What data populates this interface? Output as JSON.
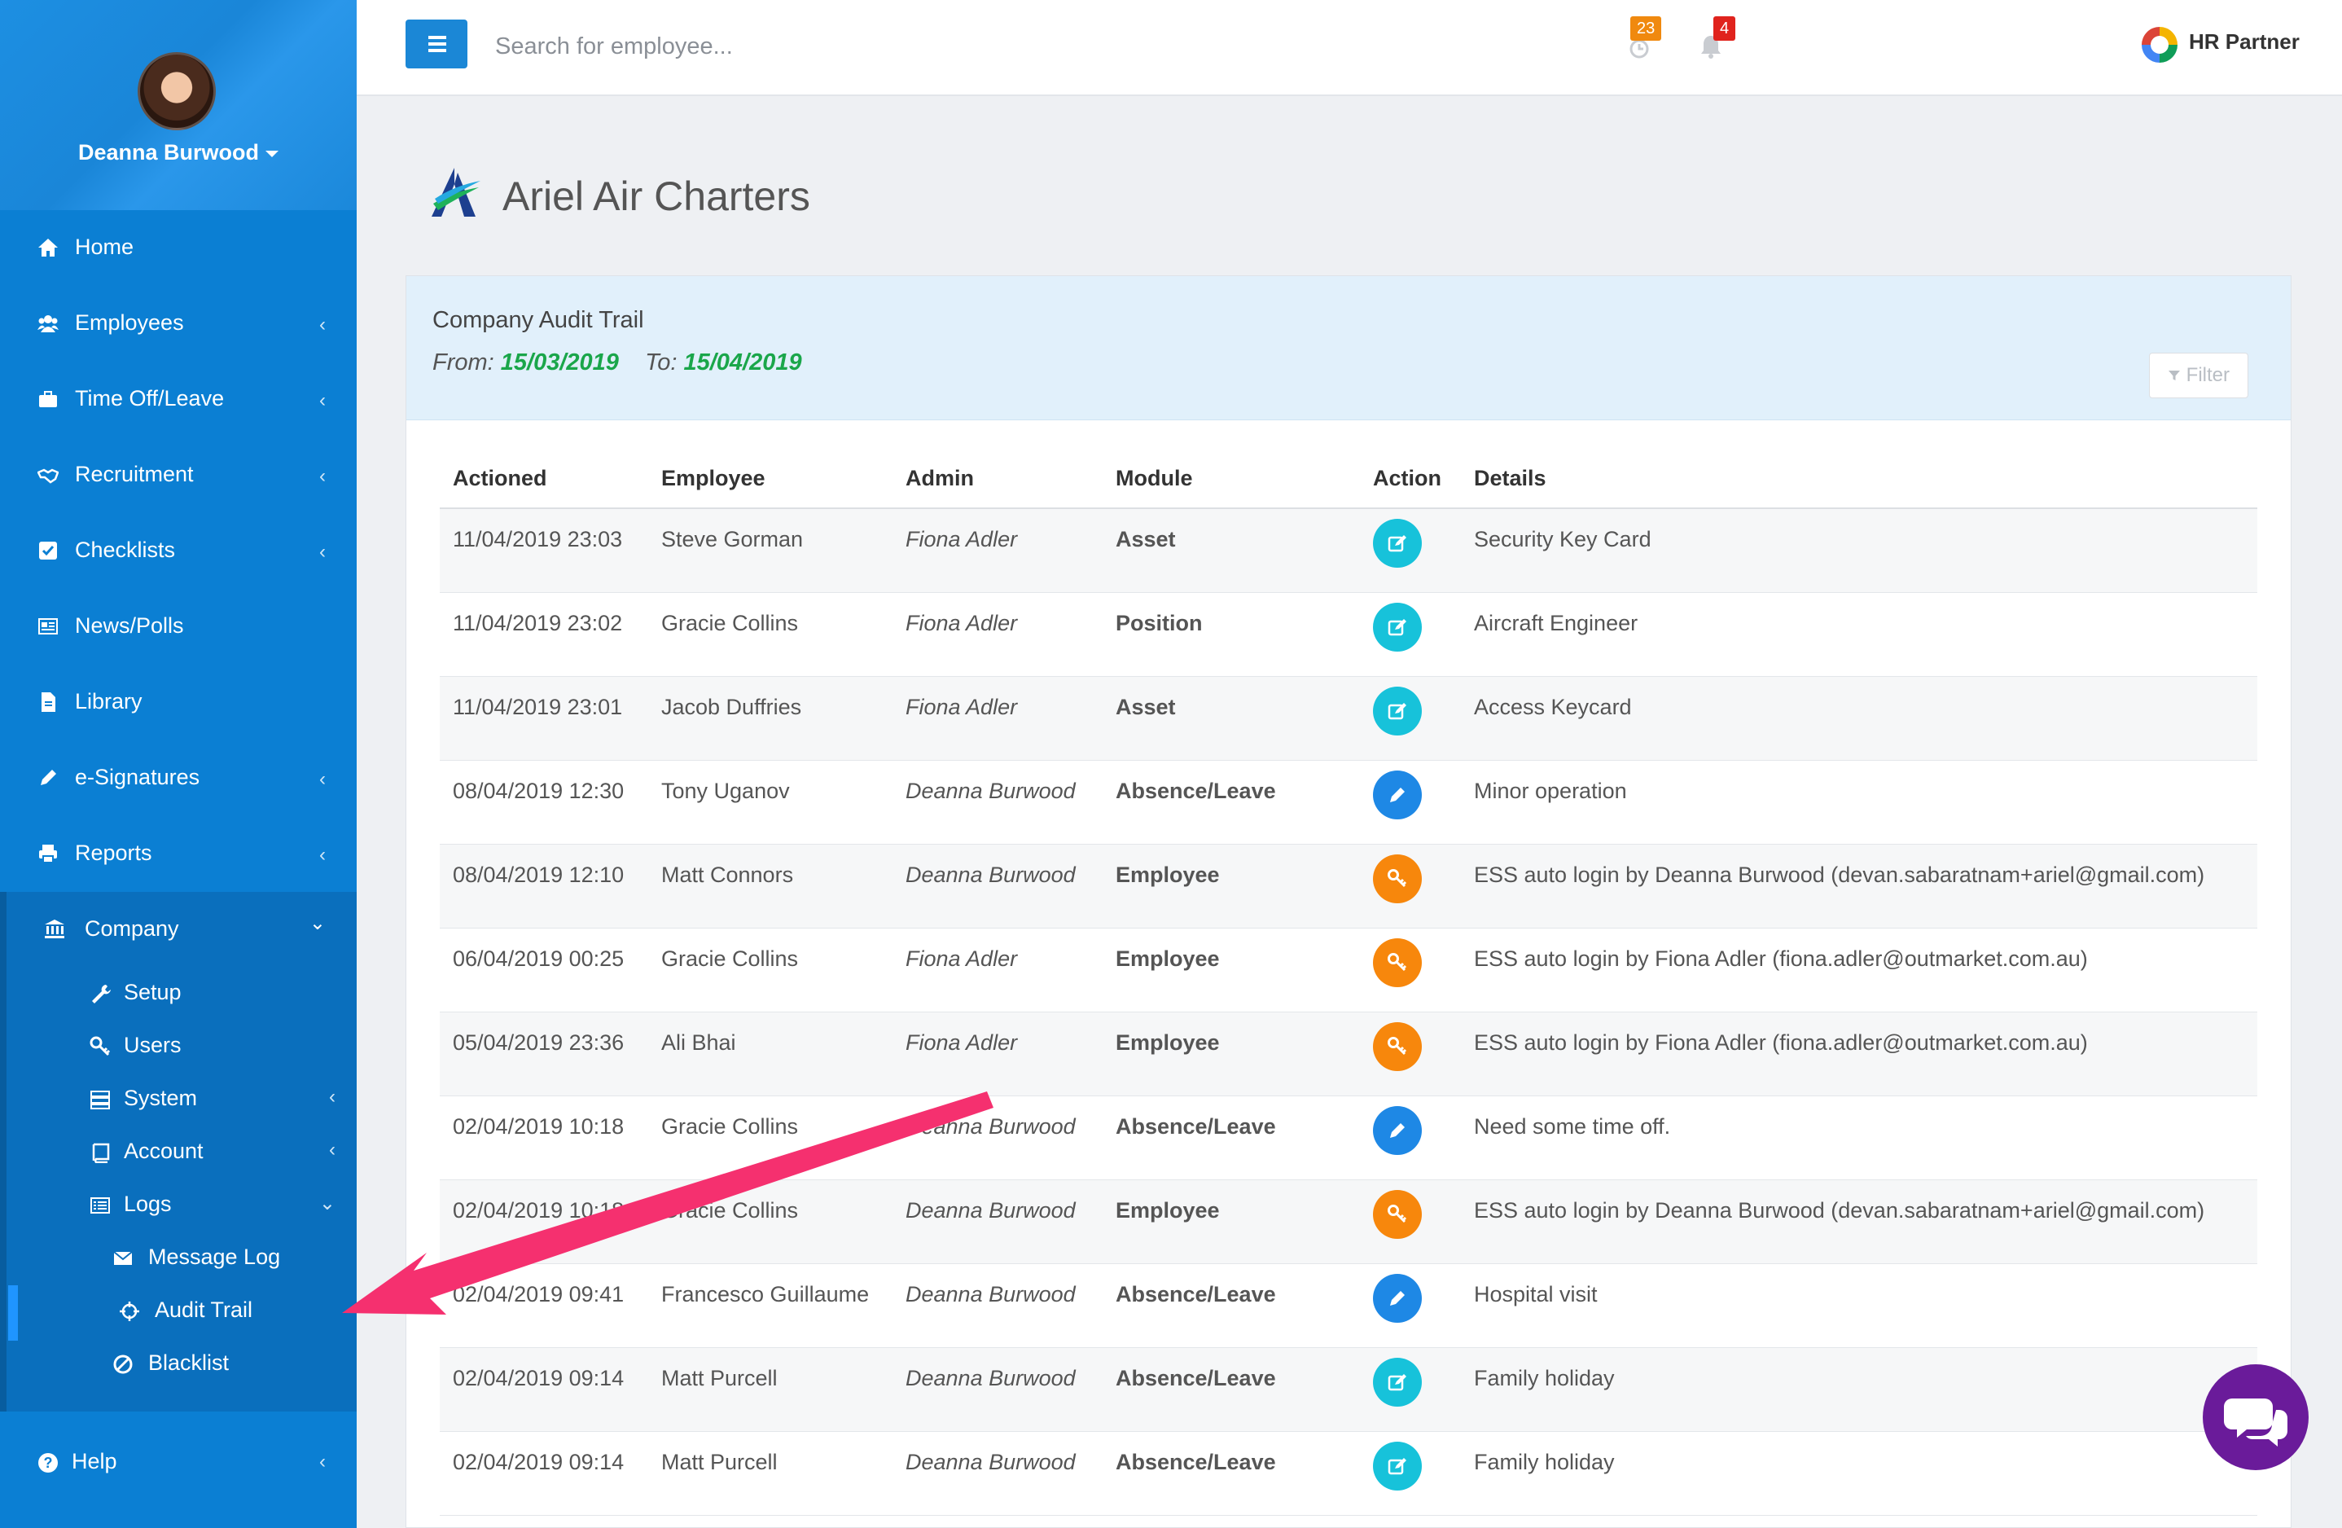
{
  "user": {
    "name": "Deanna Burwood"
  },
  "sidebar": {
    "items": [
      {
        "label": "Home",
        "icon": "home-icon",
        "chevron": ""
      },
      {
        "label": "Employees",
        "icon": "users-icon",
        "chevron": "‹"
      },
      {
        "label": "Time Off/Leave",
        "icon": "briefcase-icon",
        "chevron": "‹"
      },
      {
        "label": "Recruitment",
        "icon": "handshake-icon",
        "chevron": "‹"
      },
      {
        "label": "Checklists",
        "icon": "checkbox-icon",
        "chevron": "‹"
      },
      {
        "label": "News/Polls",
        "icon": "newspaper-icon",
        "chevron": ""
      },
      {
        "label": "Library",
        "icon": "file-icon",
        "chevron": ""
      },
      {
        "label": "e-Signatures",
        "icon": "pen-icon",
        "chevron": "‹"
      },
      {
        "label": "Reports",
        "icon": "print-icon",
        "chevron": "‹"
      }
    ],
    "company": {
      "label": "Company",
      "chevron": "⌄",
      "sub": [
        {
          "label": "Setup",
          "icon": "wrench-icon",
          "chevron": ""
        },
        {
          "label": "Users",
          "icon": "key-icon",
          "chevron": ""
        },
        {
          "label": "System",
          "icon": "server-icon",
          "chevron": "‹"
        },
        {
          "label": "Account",
          "icon": "book-icon",
          "chevron": "‹"
        },
        {
          "label": "Logs",
          "icon": "list-icon",
          "chevron": "⌄"
        }
      ],
      "logs": [
        {
          "label": "Message Log",
          "icon": "envelope-icon"
        },
        {
          "label": "Audit Trail",
          "icon": "crosshair-icon"
        },
        {
          "label": "Blacklist",
          "icon": "ban-icon"
        }
      ]
    },
    "help": {
      "label": "Help",
      "chevron": "‹"
    }
  },
  "topbar": {
    "search_placeholder": "Search for employee...",
    "badge_count_1": "23",
    "badge_count_2": "4",
    "brand": "HR Partner"
  },
  "company": {
    "name": "Ariel Air Charters"
  },
  "audit": {
    "title": "Company Audit Trail",
    "from_label": "From:",
    "from": "15/03/2019",
    "to_label": "To:",
    "to": "15/04/2019",
    "filter_label": "Filter",
    "columns": [
      "Actioned",
      "Employee",
      "Admin",
      "Module",
      "Action",
      "Details"
    ],
    "rows": [
      {
        "actioned": "11/04/2019 23:03",
        "employee": "Steve Gorman",
        "admin": "Fiona Adler",
        "module": "Asset",
        "action": "edit",
        "details": "Security Key Card"
      },
      {
        "actioned": "11/04/2019 23:02",
        "employee": "Gracie Collins",
        "admin": "Fiona Adler",
        "module": "Position",
        "action": "edit",
        "details": "Aircraft Engineer"
      },
      {
        "actioned": "11/04/2019 23:01",
        "employee": "Jacob Duffries",
        "admin": "Fiona Adler",
        "module": "Asset",
        "action": "edit",
        "details": "Access Keycard"
      },
      {
        "actioned": "08/04/2019 12:30",
        "employee": "Tony Uganov",
        "admin": "Deanna Burwood",
        "module": "Absence/Leave",
        "action": "pencil",
        "details": "Minor operation"
      },
      {
        "actioned": "08/04/2019 12:10",
        "employee": "Matt Connors",
        "admin": "Deanna Burwood",
        "module": "Employee",
        "action": "key",
        "details": "ESS auto login by Deanna Burwood (devan.sabaratnam+ariel@gmail.com)"
      },
      {
        "actioned": "06/04/2019 00:25",
        "employee": "Gracie Collins",
        "admin": "Fiona Adler",
        "module": "Employee",
        "action": "key",
        "details": "ESS auto login by Fiona Adler (fiona.adler@outmarket.com.au)"
      },
      {
        "actioned": "05/04/2019 23:36",
        "employee": "Ali Bhai",
        "admin": "Fiona Adler",
        "module": "Employee",
        "action": "key",
        "details": "ESS auto login by Fiona Adler (fiona.adler@outmarket.com.au)"
      },
      {
        "actioned": "02/04/2019 10:18",
        "employee": "Gracie Collins",
        "admin": "Deanna Burwood",
        "module": "Absence/Leave",
        "action": "pencil",
        "details": "Need some time off."
      },
      {
        "actioned": "02/04/2019 10:18",
        "employee": "Gracie Collins",
        "admin": "Deanna Burwood",
        "module": "Employee",
        "action": "key",
        "details": "ESS auto login by Deanna Burwood (devan.sabaratnam+ariel@gmail.com)"
      },
      {
        "actioned": "02/04/2019 09:41",
        "employee": "Francesco Guillaume",
        "admin": "Deanna Burwood",
        "module": "Absence/Leave",
        "action": "pencil",
        "details": "Hospital visit"
      },
      {
        "actioned": "02/04/2019 09:14",
        "employee": "Matt Purcell",
        "admin": "Deanna Burwood",
        "module": "Absence/Leave",
        "action": "edit",
        "details": "Family holiday"
      },
      {
        "actioned": "02/04/2019 09:14",
        "employee": "Matt Purcell",
        "admin": "Deanna Burwood",
        "module": "Absence/Leave",
        "action": "edit",
        "details": "Family holiday"
      }
    ]
  },
  "colors": {
    "sidebar": "#0b7fd3",
    "accent_green": "#1aa64a",
    "link_blue": "#1b7dcc",
    "annotation_arrow": "#f5306f",
    "chat": "#6a1b9a"
  }
}
